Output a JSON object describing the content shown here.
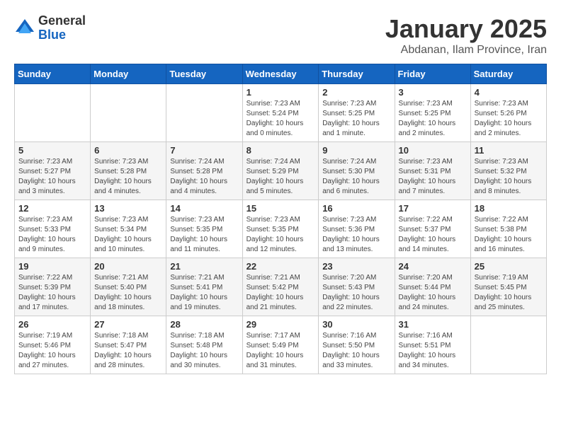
{
  "logo": {
    "general": "General",
    "blue": "Blue"
  },
  "title": {
    "month_year": "January 2025",
    "location": "Abdanan, Ilam Province, Iran"
  },
  "weekdays": [
    "Sunday",
    "Monday",
    "Tuesday",
    "Wednesday",
    "Thursday",
    "Friday",
    "Saturday"
  ],
  "weeks": [
    [
      {
        "day": "",
        "info": ""
      },
      {
        "day": "",
        "info": ""
      },
      {
        "day": "",
        "info": ""
      },
      {
        "day": "1",
        "info": "Sunrise: 7:23 AM\nSunset: 5:24 PM\nDaylight: 10 hours\nand 0 minutes."
      },
      {
        "day": "2",
        "info": "Sunrise: 7:23 AM\nSunset: 5:25 PM\nDaylight: 10 hours\nand 1 minute."
      },
      {
        "day": "3",
        "info": "Sunrise: 7:23 AM\nSunset: 5:25 PM\nDaylight: 10 hours\nand 2 minutes."
      },
      {
        "day": "4",
        "info": "Sunrise: 7:23 AM\nSunset: 5:26 PM\nDaylight: 10 hours\nand 2 minutes."
      }
    ],
    [
      {
        "day": "5",
        "info": "Sunrise: 7:23 AM\nSunset: 5:27 PM\nDaylight: 10 hours\nand 3 minutes."
      },
      {
        "day": "6",
        "info": "Sunrise: 7:23 AM\nSunset: 5:28 PM\nDaylight: 10 hours\nand 4 minutes."
      },
      {
        "day": "7",
        "info": "Sunrise: 7:24 AM\nSunset: 5:28 PM\nDaylight: 10 hours\nand 4 minutes."
      },
      {
        "day": "8",
        "info": "Sunrise: 7:24 AM\nSunset: 5:29 PM\nDaylight: 10 hours\nand 5 minutes."
      },
      {
        "day": "9",
        "info": "Sunrise: 7:24 AM\nSunset: 5:30 PM\nDaylight: 10 hours\nand 6 minutes."
      },
      {
        "day": "10",
        "info": "Sunrise: 7:23 AM\nSunset: 5:31 PM\nDaylight: 10 hours\nand 7 minutes."
      },
      {
        "day": "11",
        "info": "Sunrise: 7:23 AM\nSunset: 5:32 PM\nDaylight: 10 hours\nand 8 minutes."
      }
    ],
    [
      {
        "day": "12",
        "info": "Sunrise: 7:23 AM\nSunset: 5:33 PM\nDaylight: 10 hours\nand 9 minutes."
      },
      {
        "day": "13",
        "info": "Sunrise: 7:23 AM\nSunset: 5:34 PM\nDaylight: 10 hours\nand 10 minutes."
      },
      {
        "day": "14",
        "info": "Sunrise: 7:23 AM\nSunset: 5:35 PM\nDaylight: 10 hours\nand 11 minutes."
      },
      {
        "day": "15",
        "info": "Sunrise: 7:23 AM\nSunset: 5:35 PM\nDaylight: 10 hours\nand 12 minutes."
      },
      {
        "day": "16",
        "info": "Sunrise: 7:23 AM\nSunset: 5:36 PM\nDaylight: 10 hours\nand 13 minutes."
      },
      {
        "day": "17",
        "info": "Sunrise: 7:22 AM\nSunset: 5:37 PM\nDaylight: 10 hours\nand 14 minutes."
      },
      {
        "day": "18",
        "info": "Sunrise: 7:22 AM\nSunset: 5:38 PM\nDaylight: 10 hours\nand 16 minutes."
      }
    ],
    [
      {
        "day": "19",
        "info": "Sunrise: 7:22 AM\nSunset: 5:39 PM\nDaylight: 10 hours\nand 17 minutes."
      },
      {
        "day": "20",
        "info": "Sunrise: 7:21 AM\nSunset: 5:40 PM\nDaylight: 10 hours\nand 18 minutes."
      },
      {
        "day": "21",
        "info": "Sunrise: 7:21 AM\nSunset: 5:41 PM\nDaylight: 10 hours\nand 19 minutes."
      },
      {
        "day": "22",
        "info": "Sunrise: 7:21 AM\nSunset: 5:42 PM\nDaylight: 10 hours\nand 21 minutes."
      },
      {
        "day": "23",
        "info": "Sunrise: 7:20 AM\nSunset: 5:43 PM\nDaylight: 10 hours\nand 22 minutes."
      },
      {
        "day": "24",
        "info": "Sunrise: 7:20 AM\nSunset: 5:44 PM\nDaylight: 10 hours\nand 24 minutes."
      },
      {
        "day": "25",
        "info": "Sunrise: 7:19 AM\nSunset: 5:45 PM\nDaylight: 10 hours\nand 25 minutes."
      }
    ],
    [
      {
        "day": "26",
        "info": "Sunrise: 7:19 AM\nSunset: 5:46 PM\nDaylight: 10 hours\nand 27 minutes."
      },
      {
        "day": "27",
        "info": "Sunrise: 7:18 AM\nSunset: 5:47 PM\nDaylight: 10 hours\nand 28 minutes."
      },
      {
        "day": "28",
        "info": "Sunrise: 7:18 AM\nSunset: 5:48 PM\nDaylight: 10 hours\nand 30 minutes."
      },
      {
        "day": "29",
        "info": "Sunrise: 7:17 AM\nSunset: 5:49 PM\nDaylight: 10 hours\nand 31 minutes."
      },
      {
        "day": "30",
        "info": "Sunrise: 7:16 AM\nSunset: 5:50 PM\nDaylight: 10 hours\nand 33 minutes."
      },
      {
        "day": "31",
        "info": "Sunrise: 7:16 AM\nSunset: 5:51 PM\nDaylight: 10 hours\nand 34 minutes."
      },
      {
        "day": "",
        "info": ""
      }
    ]
  ]
}
